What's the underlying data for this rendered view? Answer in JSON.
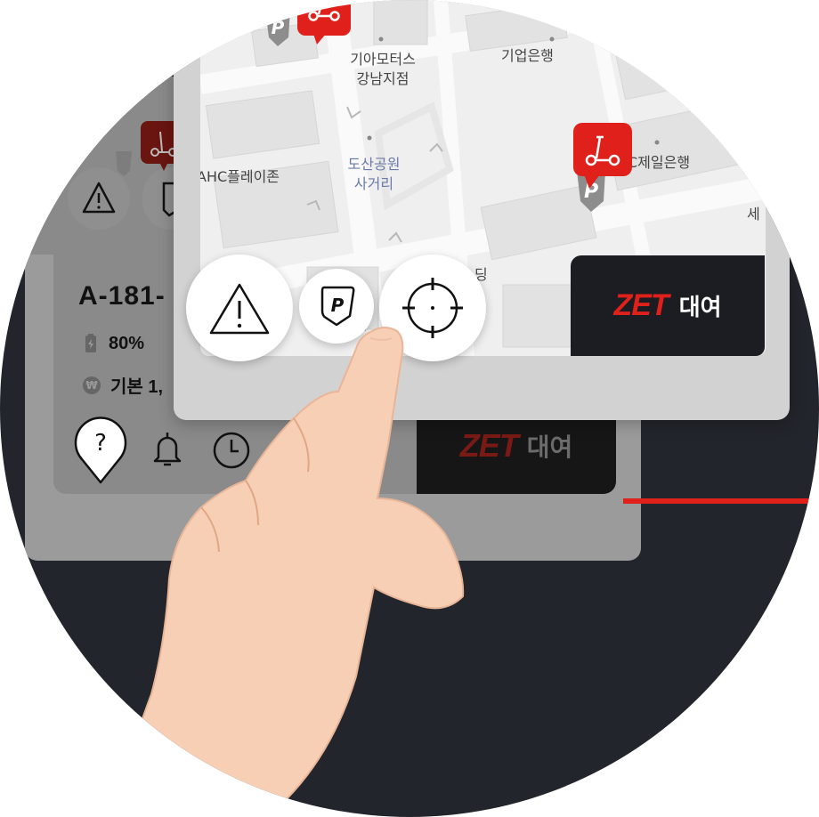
{
  "back_panel": {
    "plate": "A-181-",
    "battery": "80%",
    "fare": "기본 1,",
    "rent_brand": "ZET",
    "rent_label": "대여"
  },
  "map": {
    "labels": {
      "kia": "기아모터스\n강남지점",
      "ibk": "기업은행",
      "ahc": "AHC플레이존",
      "dosan": "도산공원\n사거리",
      "sc": "C제일은행",
      "se": "세",
      "haeng": "행",
      "dong": "딩"
    }
  },
  "front_panel": {
    "rent_brand": "ZET",
    "rent_label": "대여"
  },
  "icons": [
    "warning-icon",
    "parking-icon",
    "locate-icon",
    "help-icon",
    "bell-icon",
    "clock-icon",
    "scooter-icon"
  ],
  "colors": {
    "brand_red": "#e0211b",
    "dark": "#1c1d22",
    "map_bg": "#efefef"
  }
}
